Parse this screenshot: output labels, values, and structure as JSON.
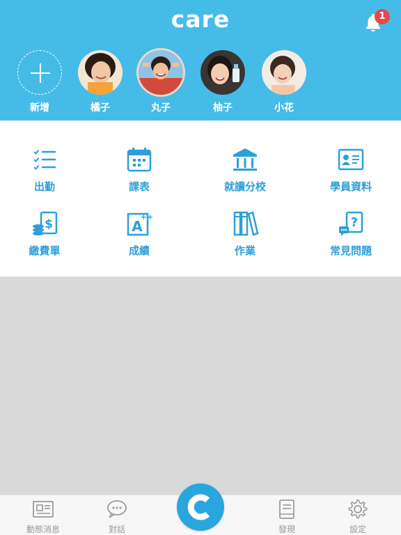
{
  "header": {
    "logo": "care",
    "notification_count": "1"
  },
  "children": [
    {
      "name": "新增",
      "type": "add"
    },
    {
      "name": "橘子",
      "type": "child"
    },
    {
      "name": "丸子",
      "type": "child",
      "active": true
    },
    {
      "name": "柚子",
      "type": "child"
    },
    {
      "name": "小花",
      "type": "child"
    }
  ],
  "menu": [
    {
      "label": "出勤",
      "icon": "checklist-icon"
    },
    {
      "label": "課表",
      "icon": "calendar-icon"
    },
    {
      "label": "就讀分校",
      "icon": "school-building-icon"
    },
    {
      "label": "學員資料",
      "icon": "id-card-icon"
    },
    {
      "label": "繳費單",
      "icon": "payment-icon"
    },
    {
      "label": "成績",
      "icon": "grade-icon"
    },
    {
      "label": "作業",
      "icon": "books-icon"
    },
    {
      "label": "常見問題",
      "icon": "faq-icon"
    }
  ],
  "tabbar": [
    {
      "label": "動態消息",
      "icon": "newspaper-icon"
    },
    {
      "label": "對話",
      "icon": "chat-bubble-icon"
    },
    {
      "label": "",
      "icon": "care-logo-icon"
    },
    {
      "label": "發現",
      "icon": "book-icon"
    },
    {
      "label": "設定",
      "icon": "gear-icon"
    }
  ],
  "colors": {
    "header_blue": "#45bce8",
    "menu_blue": "#2d9fd9",
    "badge_red": "#e84a4a",
    "background_gray": "#d9d9d9"
  }
}
